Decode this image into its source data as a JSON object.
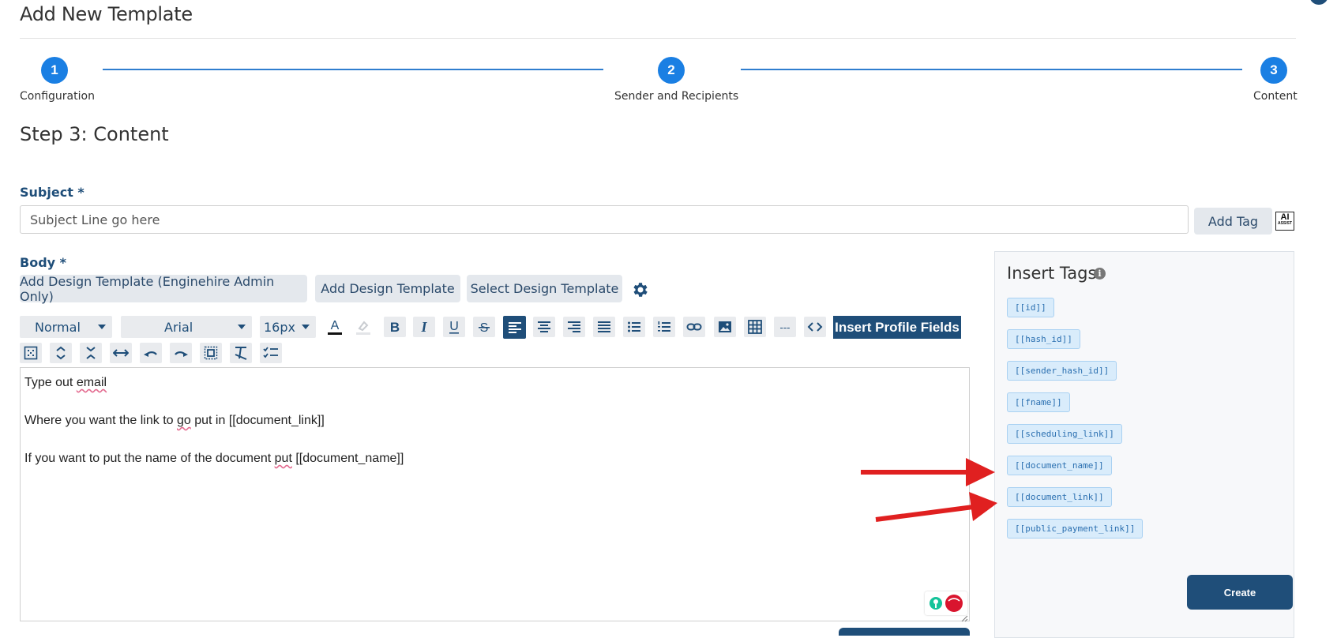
{
  "page_title": "Add New Template",
  "steps": [
    {
      "number": "1",
      "label": "Configuration"
    },
    {
      "number": "2",
      "label": "Sender and Recipients"
    },
    {
      "number": "3",
      "label": "Content"
    }
  ],
  "step_heading": "Step 3: Content",
  "subject": {
    "label": "Subject *",
    "placeholder": "Subject Line go here",
    "add_tag_label": "Add Tag",
    "ai_badge": "AI",
    "ai_badge_sub": "ASSIST"
  },
  "body": {
    "label": "Body *",
    "design_buttons": [
      "Add Design Template (Enginehire Admin Only)",
      "Add Design Template",
      "Select Design Template"
    ]
  },
  "toolbar": {
    "style_select": "Normal",
    "font_select": "Arial",
    "size_select": "16px",
    "hr_label": "---",
    "insert_profile_fields": "Insert Profile Fields"
  },
  "editor": {
    "line1_a": "Type out ",
    "line1_b": "email",
    "line2_a": "Where you want the link to ",
    "line2_b": "go",
    "line2_c": " put in [[document_link]]",
    "line3_a": "If you want to put the name of the document ",
    "line3_b": "put",
    "line3_c": " [[document_name]]"
  },
  "insert_tags": {
    "title": "Insert Tags",
    "info_icon": "i",
    "tags": [
      "[[id]]",
      "[[hash_id]]",
      "[[sender_hash_id]]",
      "[[fname]]",
      "[[scheduling_link]]",
      "[[document_name]]",
      "[[document_link]]",
      "[[public_payment_link]]"
    ]
  },
  "create_label": "Create",
  "colors": {
    "accent": "#1a7fe3",
    "primary_dark": "#1f4e79",
    "annotation_arrow": "#e02020"
  }
}
